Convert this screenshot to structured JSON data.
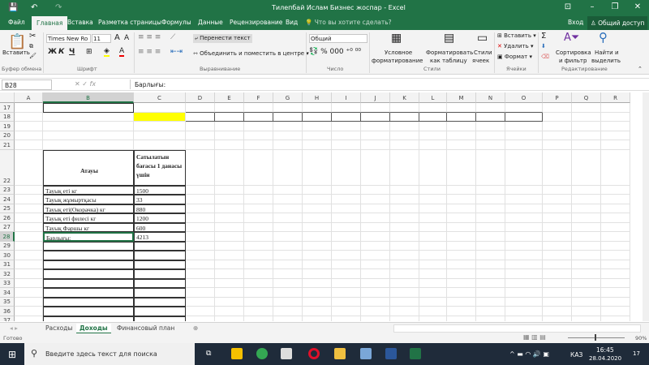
{
  "window": {
    "title": "Тилепбай Ислам Бизнес жоспар - Excel"
  },
  "tabs": [
    "Файл",
    "Главная",
    "Вставка",
    "Разметка страницы",
    "Формулы",
    "Данные",
    "Рецензирование",
    "Вид"
  ],
  "tell_me": "Что вы хотите сделать?",
  "signin": "Вход",
  "share": "Общий доступ",
  "ribbon": {
    "paste": "Вставить",
    "font_name": "Times New Ro",
    "font_size": "11",
    "bold": "Ж",
    "italic": "К",
    "underline": "Ч",
    "wrap_text": "Перенести текст",
    "merge_center": "Объединить и поместить в центре",
    "number_format": "Общий",
    "cond_format_1": "Условное",
    "cond_format_2": "форматирование",
    "format_table_1": "Форматировать",
    "format_table_2": "как таблицу",
    "cell_styles_1": "Стили",
    "cell_styles_2": "ячеек",
    "insert": "Вставить",
    "delete": "Удалить",
    "format": "Формат",
    "sort_1": "Сортировка",
    "sort_2": "и фильтр",
    "find_1": "Найти и",
    "find_2": "выделить",
    "groups": {
      "clipboard": "Буфер обмена",
      "font": "Шрифт",
      "alignment": "Выравнивание",
      "number": "Число",
      "styles": "Стили",
      "cells": "Ячейки",
      "editing": "Редактирование"
    }
  },
  "formula_bar": {
    "name_box": "B28",
    "formula": "Барлығы:"
  },
  "columns": [
    "A",
    "B",
    "C",
    "D",
    "E",
    "F",
    "G",
    "H",
    "I",
    "J",
    "K",
    "L",
    "M",
    "N",
    "O",
    "P",
    "Q",
    "R"
  ],
  "rows": [
    "17",
    "18",
    "19",
    "20",
    "21",
    "22",
    "23",
    "24",
    "25",
    "26",
    "27",
    "28",
    "29",
    "30",
    "31",
    "32",
    "33",
    "34",
    "35",
    "36",
    "37"
  ],
  "table": {
    "header_name": "Атауы",
    "header_price": "Сатылатын бағасы 1 данасы үшін",
    "items": [
      {
        "name": "Тауық еті кг",
        "price": "1500"
      },
      {
        "name": "Тауық жұмыртқасы",
        "price": "33"
      },
      {
        "name": "Тауық еті(Окорачка) кг",
        "price": "880"
      },
      {
        "name": "Тауық еті филесі кг",
        "price": "1200"
      },
      {
        "name": " Тауық Фаршы кг",
        "price": "600"
      },
      {
        "name": "Барлығы:",
        "price": "4213"
      }
    ]
  },
  "sheets": [
    "Расходы",
    "Доходы",
    "Финансовый план"
  ],
  "status": {
    "ready": "Готово",
    "zoom": "90%"
  },
  "taskbar": {
    "search": "Введите здесь текст для поиска",
    "lang": "КАЗ",
    "time": "16:45",
    "date": "28.04.2020",
    "notifications": "17"
  },
  "colors": {
    "excel_green": "#217346",
    "highlight_yellow": "#ffff00"
  }
}
